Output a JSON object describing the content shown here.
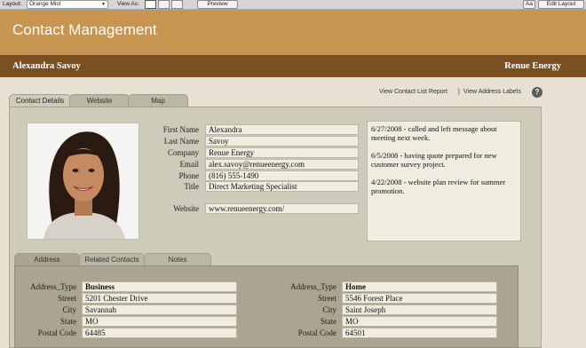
{
  "statusbar": {
    "layout_label": "Layout:",
    "layout_value": "Orange Mist",
    "viewas_label": "View As:",
    "preview_label": "Preview",
    "font_label": "Aa",
    "edit_layout_label": "Edit Layout"
  },
  "header": {
    "title": "Contact Management"
  },
  "namebar": {
    "name": "Alexandra Savoy",
    "company": "Renue Energy"
  },
  "tabs": [
    {
      "label": "Contact Details"
    },
    {
      "label": "Website"
    },
    {
      "label": "Map"
    }
  ],
  "links": {
    "contact_list": "View Contact List Report",
    "separator": "|",
    "address_labels": "View Address Labels",
    "help": "?"
  },
  "contact": {
    "first_name_label": "First Name",
    "first_name": "Alexandra",
    "last_name_label": "Last Name",
    "last_name": "Savoy",
    "company_label": "Company",
    "company": "Renue Energy",
    "email_label": "Email",
    "email": "alex.savoy@renueenergy.com",
    "phone_label": "Phone",
    "phone": "(816) 555-1490",
    "title_label": "Title",
    "title": "Direct Marketing Specialist",
    "website_label": "Website",
    "website": "www.renueenergy.com/"
  },
  "notes": [
    "6/27/2008 - called and left message about meeting next week.",
    "6/5/2008 - having quote prepared for new customer survey project.",
    "4/22/2008 - website plan review for summer promotion."
  ],
  "bottom_tabs": [
    {
      "label": "Address"
    },
    {
      "label": "Related Contacts"
    },
    {
      "label": "Notes"
    }
  ],
  "addresses": {
    "type_label": "Address_Type",
    "street_label": "Street",
    "city_label": "City",
    "state_label": "State",
    "postal_label": "Postal Code",
    "business": {
      "type": "Business",
      "street": "5201 Chester Drive",
      "city": "Savannah",
      "state": "MO",
      "postal": "64485"
    },
    "home": {
      "type": "Home",
      "street": "5546 Forest Place",
      "city": "Saint Joseph",
      "state": "MO",
      "postal": "64501"
    }
  },
  "colors": {
    "header": "#c79550",
    "namebar": "#7a4f22",
    "panel": "#cfcbba",
    "address_panel": "#a9a591"
  }
}
